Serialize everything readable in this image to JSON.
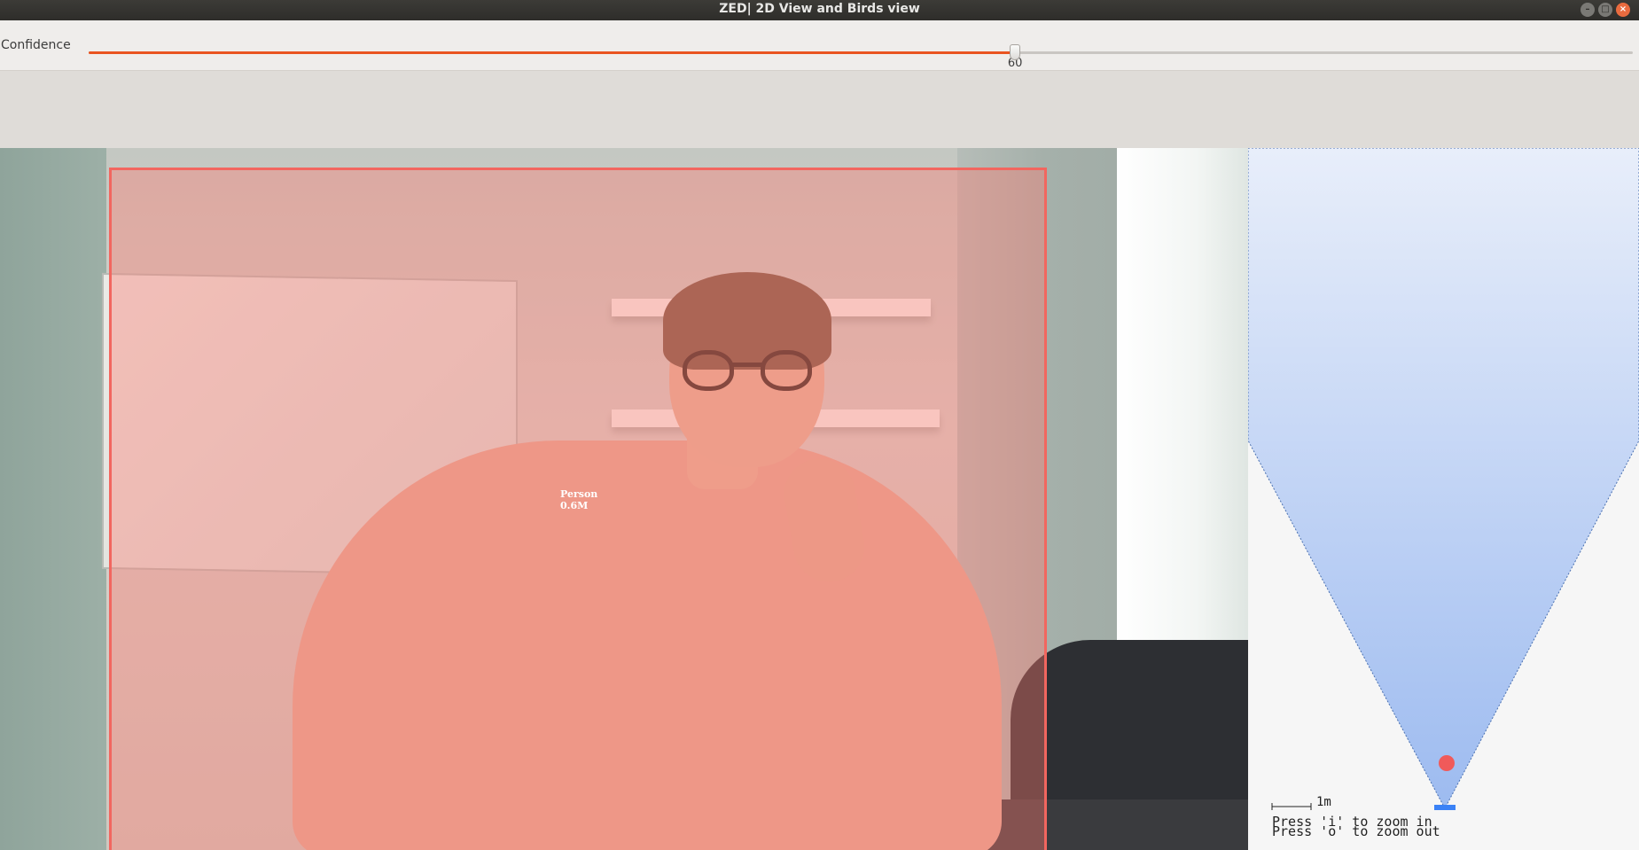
{
  "window": {
    "title": "ZED| 2D View and Birds view"
  },
  "controls": {
    "confidence_label": "Confidence",
    "confidence_value": 60,
    "confidence_min": 0,
    "confidence_max": 100,
    "accent_color": "#e95420"
  },
  "camera_view": {
    "detections": [
      {
        "label": "Person",
        "distance": "0.6M",
        "color": "#f2665f"
      }
    ]
  },
  "birds_view": {
    "scale_label": "1m",
    "hint_zoom_in": "Press 'i' to zoom in",
    "hint_zoom_out": "Press 'o' to zoom out",
    "fov_color": "#a9c3f0",
    "object_color": "#f05a5a",
    "camera_color": "#3b82f6"
  }
}
